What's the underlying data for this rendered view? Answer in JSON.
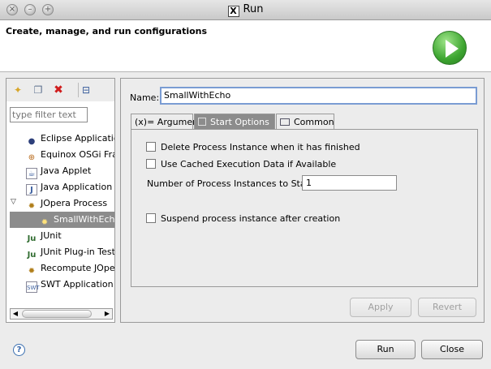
{
  "window": {
    "title": "Run"
  },
  "banner": {
    "text": "Create, manage, and run configurations"
  },
  "sidebar": {
    "filter_placeholder": "type filter text",
    "items": [
      {
        "label": "Eclipse Application",
        "icon": "eclipse-icon"
      },
      {
        "label": "Equinox OSGi Fran",
        "icon": "osgi-icon"
      },
      {
        "label": "Java Applet",
        "icon": "java-applet-icon"
      },
      {
        "label": "Java Application",
        "icon": "java-app-icon"
      },
      {
        "label": "JOpera Process",
        "icon": "jopera-icon"
      },
      {
        "label": "SmallWithEcho",
        "icon": "jopera-config-icon"
      },
      {
        "label": "JUnit",
        "icon": "junit-icon"
      },
      {
        "label": "JUnit Plug-in Test",
        "icon": "junit-plugin-icon"
      },
      {
        "label": "Recompute JOpera",
        "icon": "recompute-icon"
      },
      {
        "label": "SWT Application",
        "icon": "swt-icon"
      }
    ]
  },
  "main": {
    "name_label": "Name:",
    "name_value": "SmallWithEcho",
    "tabs": [
      {
        "label": "(x)= Arguments"
      },
      {
        "label": "Start Options"
      },
      {
        "label": "Common"
      }
    ],
    "options": {
      "delete_instance": "Delete Process Instance when it has finished",
      "use_cached": "Use Cached Execution Data if Available",
      "instances_label": "Number of Process Instances to Start:",
      "instances_value": "1",
      "suspend": "Suspend process instance after creation"
    },
    "apply_label": "Apply",
    "revert_label": "Revert"
  },
  "footer": {
    "run_label": "Run",
    "close_label": "Close"
  },
  "colors": {
    "selection": "#8c8c8c",
    "run_green": "#3da530",
    "focus_border": "#7a9cd3"
  }
}
